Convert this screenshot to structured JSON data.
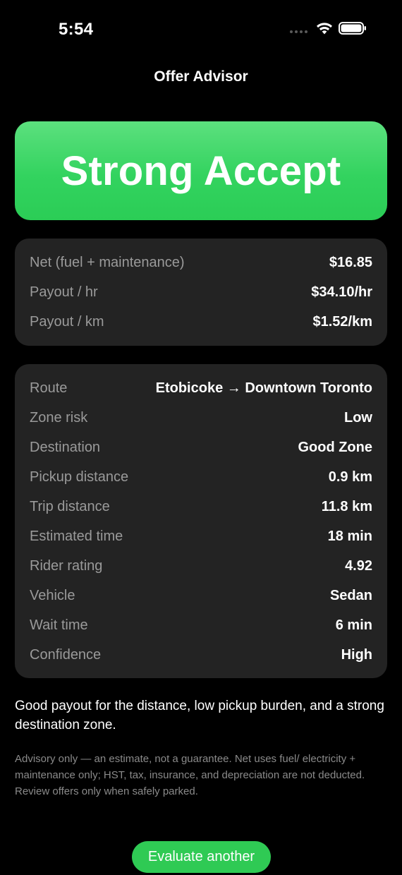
{
  "status_bar": {
    "time": "5:54"
  },
  "nav": {
    "title": "Offer Advisor"
  },
  "verdict": {
    "label": "Strong Accept",
    "color": "#34d35f"
  },
  "economics": [
    {
      "label": "Net (fuel + maintenance)",
      "value": "$16.85"
    },
    {
      "label": "Payout / hr",
      "value": "$34.10/hr"
    },
    {
      "label": "Payout / km",
      "value": "$1.52/km"
    }
  ],
  "details": [
    {
      "label": "Route",
      "value": "Etobicoke → Downtown Toronto"
    },
    {
      "label": "Zone risk",
      "value": "Low"
    },
    {
      "label": "Destination",
      "value": "Good Zone"
    },
    {
      "label": "Pickup distance",
      "value": "0.9 km"
    },
    {
      "label": "Trip distance",
      "value": "11.8 km"
    },
    {
      "label": "Estimated time",
      "value": "18 min"
    },
    {
      "label": "Rider rating",
      "value": "4.92"
    },
    {
      "label": "Vehicle",
      "value": "Sedan"
    },
    {
      "label": "Wait time",
      "value": "6 min"
    },
    {
      "label": "Confidence",
      "value": "High"
    }
  ],
  "summary": "Good payout for the distance, low pickup burden, and a strong destination zone.",
  "disclaimer": "Advisory only — an estimate, not a guarantee. Net uses fuel/ electricity + maintenance only; HST, tax, insurance, and depreciation are not deducted. Review offers only when safely parked.",
  "cta": {
    "label": "Evaluate another",
    "color": "#2fca54"
  }
}
